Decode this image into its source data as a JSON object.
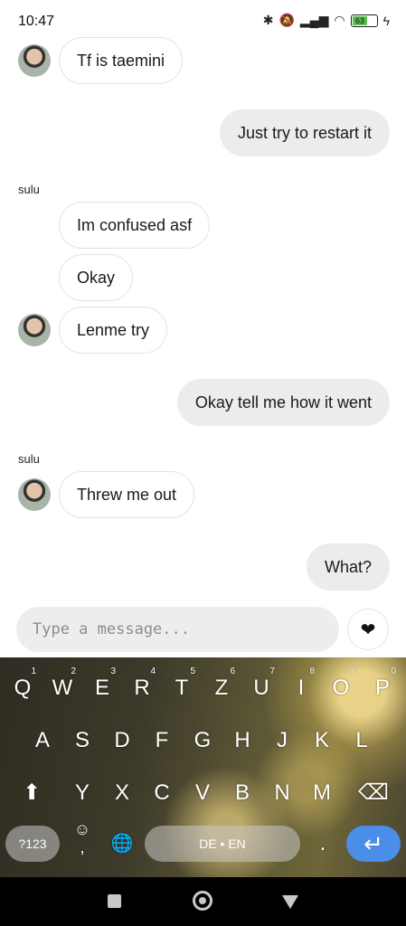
{
  "status_bar": {
    "time": "10:47",
    "battery": "63",
    "icons": [
      "bluetooth-icon",
      "mute-icon",
      "signal-icon",
      "wifi-icon",
      "battery-icon",
      "charging-icon"
    ]
  },
  "messages": [
    {
      "direction": "in",
      "text": "Tf is taemini",
      "avatar": true
    },
    {
      "direction": "out",
      "text": "Just try to restart it"
    },
    {
      "direction": "in",
      "sender": "sulu",
      "text": "Im confused asf"
    },
    {
      "direction": "in",
      "text": "Okay"
    },
    {
      "direction": "in",
      "text": "Lenme try",
      "avatar": true
    },
    {
      "direction": "out",
      "text": "Okay tell me how it went"
    },
    {
      "direction": "in",
      "sender": "sulu",
      "text": "Threw me out",
      "avatar": true
    },
    {
      "direction": "out",
      "text": "What?"
    }
  ],
  "input": {
    "placeholder": "Type a message...",
    "value": "",
    "heart_icon": "heart-icon"
  },
  "keyboard": {
    "row1": [
      {
        "k": "Q",
        "n": "1"
      },
      {
        "k": "W",
        "n": "2"
      },
      {
        "k": "E",
        "n": "3"
      },
      {
        "k": "R",
        "n": "4"
      },
      {
        "k": "T",
        "n": "5"
      },
      {
        "k": "Z",
        "n": "6"
      },
      {
        "k": "U",
        "n": "7"
      },
      {
        "k": "I",
        "n": "8"
      },
      {
        "k": "O",
        "n": "9"
      },
      {
        "k": "P",
        "n": "0"
      }
    ],
    "row2": [
      "A",
      "S",
      "D",
      "F",
      "G",
      "H",
      "J",
      "K",
      "L"
    ],
    "row3": [
      "Y",
      "X",
      "C",
      "V",
      "B",
      "N",
      "M"
    ],
    "symbols_label": "?123",
    "space_label": "DE • EN",
    "period_label": ".",
    "comma_label": ",",
    "emoji_label": "☺",
    "globe_label": "🌐",
    "shift_label": "⬆",
    "backspace_label": "⌫",
    "enter_label": "↵"
  },
  "nav_bar": {
    "buttons": [
      "recents",
      "home",
      "back"
    ]
  }
}
